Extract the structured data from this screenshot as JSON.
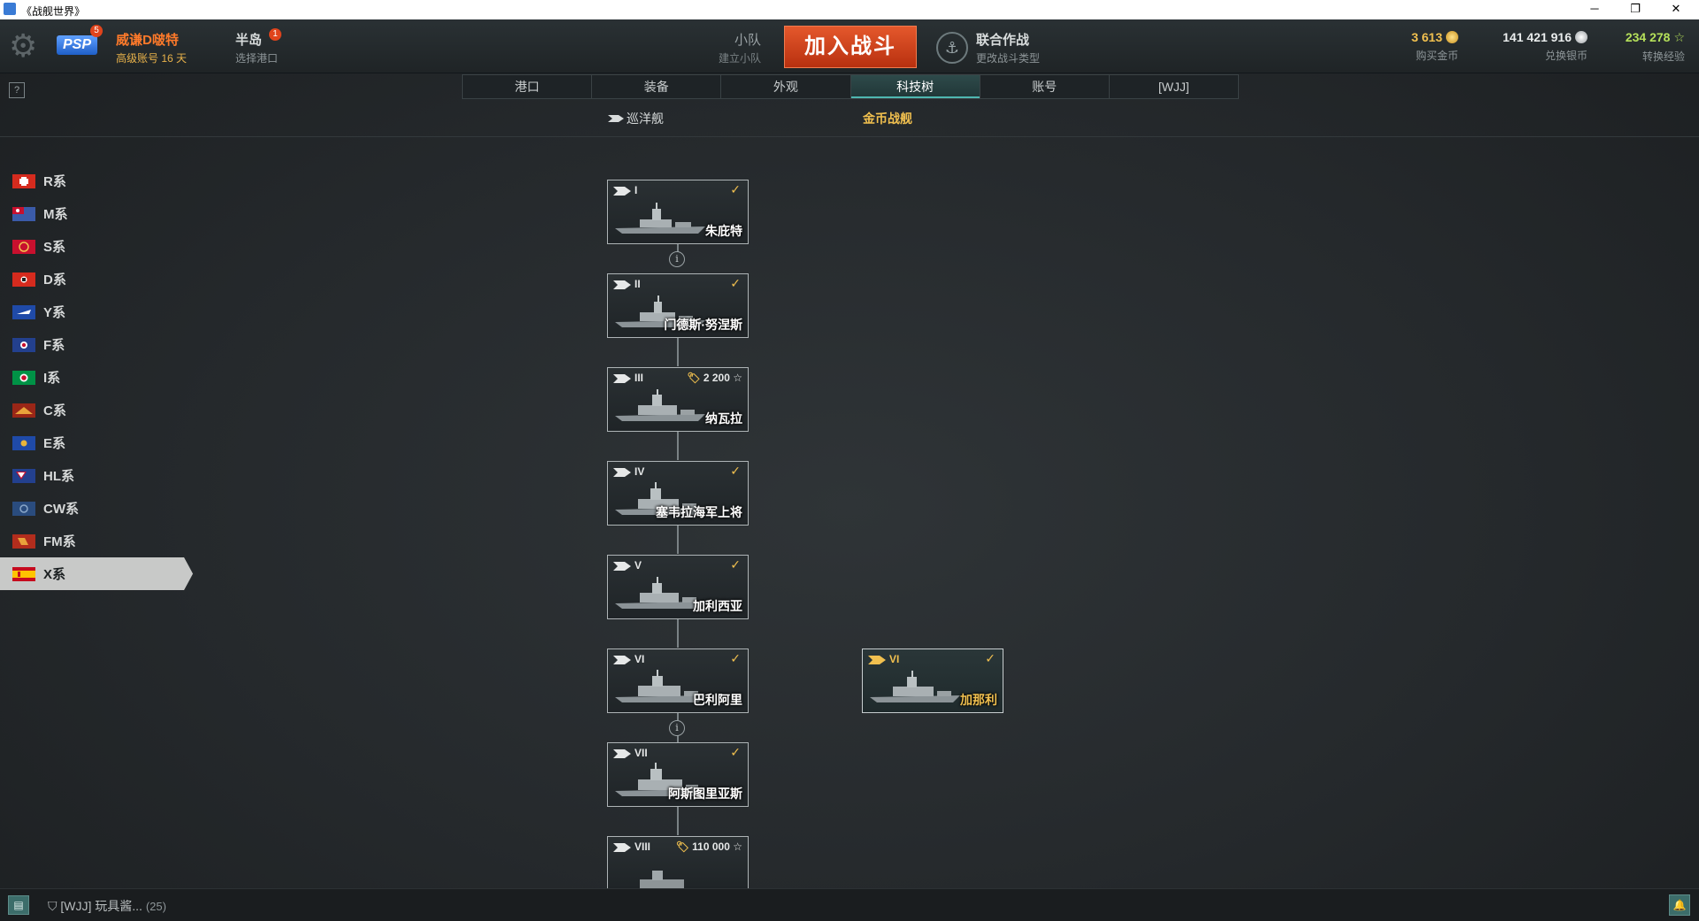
{
  "window": {
    "title": "《战舰世界》",
    "minimize": "─",
    "restore": "❐",
    "close": "✕"
  },
  "topbar": {
    "psp_badge": "5",
    "player_name": "威谦D啵特",
    "account_status": "高级账号 16 天",
    "port_name": "半岛",
    "port_sub": "选择港口",
    "port_badge": "1",
    "squad_label": "小队",
    "squad_sub": "建立小队",
    "battle_button": "加入战斗",
    "mode_name": "联合作战",
    "mode_sub": "更改战斗类型",
    "gold_value": "3 613",
    "gold_label": "购买金币",
    "silver_value": "141 421 916",
    "silver_label": "兑换银币",
    "xp_value": "234 278",
    "xp_label": "转换经验",
    "colors": {
      "gold": "#f1c04f",
      "silver": "#e9ecec",
      "xp": "#b5e05a"
    }
  },
  "tabs": [
    "港口",
    "装备",
    "外观",
    "科技树",
    "账号",
    "[WJJ]"
  ],
  "active_tab": "科技树",
  "help_icon": "?",
  "subheaders": {
    "cruiser": "巡洋舰",
    "gold_ships": "金币战舰"
  },
  "nations": [
    {
      "label": "R系",
      "icon": "flag-r"
    },
    {
      "label": "M系",
      "icon": "flag-m"
    },
    {
      "label": "S系",
      "icon": "flag-s"
    },
    {
      "label": "D系",
      "icon": "flag-d"
    },
    {
      "label": "Y系",
      "icon": "flag-y"
    },
    {
      "label": "F系",
      "icon": "flag-f"
    },
    {
      "label": "I系",
      "icon": "flag-i"
    },
    {
      "label": "C系",
      "icon": "flag-c"
    },
    {
      "label": "E系",
      "icon": "flag-e"
    },
    {
      "label": "HL系",
      "icon": "flag-hl"
    },
    {
      "label": "CW系",
      "icon": "flag-cw"
    },
    {
      "label": "FM系",
      "icon": "flag-fm"
    },
    {
      "label": "X系",
      "icon": "flag-x"
    }
  ],
  "active_nation": "X系",
  "tree": {
    "ships": [
      {
        "tier": "I",
        "name": "朱庇特",
        "researched": true
      },
      {
        "tier": "II",
        "name": "门德斯·努涅斯",
        "researched": true
      },
      {
        "tier": "III",
        "name": "纳瓦拉",
        "researched": false,
        "cost": "2 200"
      },
      {
        "tier": "IV",
        "name": "塞韦拉海军上将",
        "researched": true
      },
      {
        "tier": "V",
        "name": "加利西亚",
        "researched": true
      },
      {
        "tier": "VI",
        "name": "巴利阿里",
        "researched": true
      },
      {
        "tier": "VII",
        "name": "阿斯图里亚斯",
        "researched": true
      },
      {
        "tier": "VIII",
        "name": "",
        "researched": false,
        "cost": "110 000"
      }
    ],
    "premium": [
      {
        "tier": "VI",
        "name": "加那利",
        "researched": true
      }
    ],
    "info_icon": "i",
    "check_icon": "✓",
    "xp_icon": "☆"
  },
  "bottombar": {
    "chat_icon": "💬",
    "clan_tag": "[WJJ]",
    "clan_name": "玩具酱...",
    "clan_count": "(25)",
    "notification_icon": "bell"
  }
}
